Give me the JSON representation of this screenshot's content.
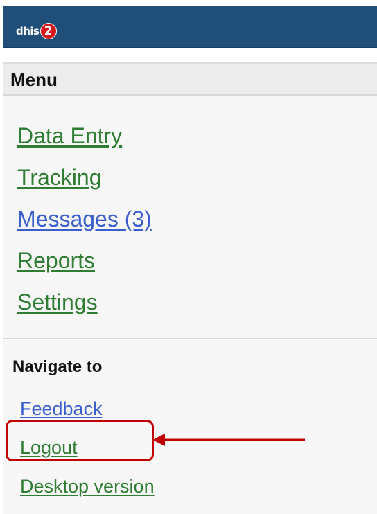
{
  "header": {
    "logo_text": "dhis",
    "logo_badge": "2"
  },
  "menu": {
    "title": "Menu",
    "items": [
      {
        "label": "Data Entry",
        "color": "#2e7d32"
      },
      {
        "label": "Tracking",
        "color": "#2e7d32"
      },
      {
        "label": "Messages (3)",
        "color": "#3a5fcd"
      },
      {
        "label": "Reports",
        "color": "#2e7d32"
      },
      {
        "label": "Settings",
        "color": "#2e7d32"
      }
    ]
  },
  "navigate": {
    "title": "Navigate to",
    "items": [
      {
        "label": "Feedback",
        "color": "#3a5fcd"
      },
      {
        "label": "Logout",
        "color": "#2e7d32"
      },
      {
        "label": "Desktop version",
        "color": "#2e7d32"
      }
    ]
  },
  "annotation": {
    "highlight_color": "#c00000",
    "highlighted_item": "Logout"
  }
}
